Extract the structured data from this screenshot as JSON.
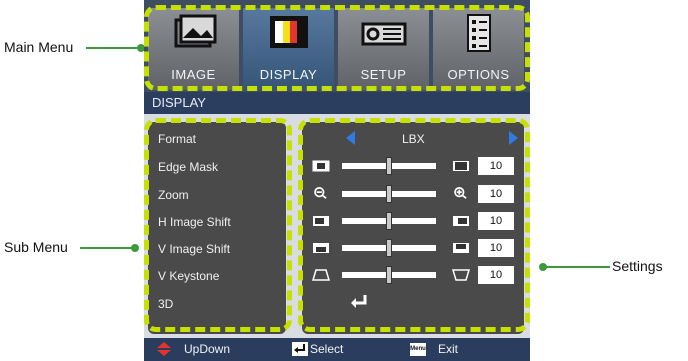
{
  "callouts": {
    "main_menu": "Main Menu",
    "sub_menu": "Sub Menu",
    "settings": "Settings"
  },
  "tabs": [
    {
      "label": "IMAGE",
      "icon": "image-icon"
    },
    {
      "label": "DISPLAY",
      "icon": "display-icon"
    },
    {
      "label": "SETUP",
      "icon": "setup-icon"
    },
    {
      "label": "OPTIONS",
      "icon": "options-icon"
    }
  ],
  "active_tab": "DISPLAY",
  "section_title": "DISPLAY",
  "sub_menu": [
    "Format",
    "Edge Mask",
    "Zoom",
    "H Image Shift",
    "V Image Shift",
    "V Keystone",
    "3D"
  ],
  "settings": {
    "format_value": "LBX",
    "values": [
      "10",
      "10",
      "10",
      "10",
      "10"
    ]
  },
  "footer": {
    "updown": "UpDown",
    "select": "Select",
    "menu_key": "Menu",
    "exit": "Exit"
  },
  "colors": {
    "highlight_dash": "#c6e000",
    "callout_line": "#3b9a3b",
    "active_tab": "#4a6a92"
  }
}
